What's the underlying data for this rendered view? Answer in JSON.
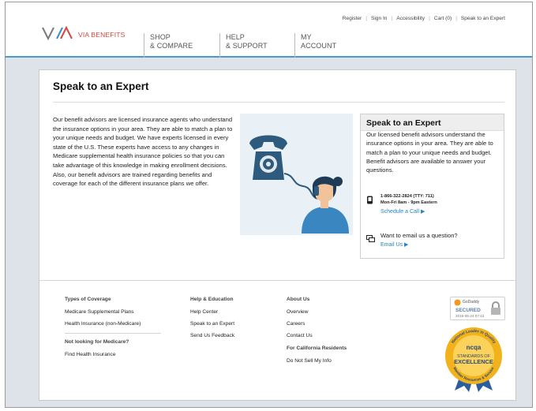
{
  "header": {
    "logo_text": "VIA BENEFITS",
    "utility": [
      "Register",
      "Sign In",
      "Accessibility",
      "Cart (0)",
      "Speak to an Expert"
    ],
    "nav": [
      {
        "line1": "SHOP",
        "line2": "& COMPARE"
      },
      {
        "line1": "HELP",
        "line2": "& SUPPORT"
      },
      {
        "line1": "MY",
        "line2": "ACCOUNT"
      }
    ]
  },
  "main": {
    "title": "Speak to an Expert",
    "intro": "Our benefit advisors are licensed insurance agents who understand the insurance options in your area. They are able to match a plan to your unique needs and budget. We have experts licensed in every state of the U.S. These experts have access to any changes in Medicare supplemental health insurance policies so that you can take advantage of this knowledge in making enrollment decisions. Also, our benefit advisors are trained regarding benefits and coverage for each of the different insurance plans we offer.",
    "panel": {
      "heading": "Speak to an Expert",
      "text": "Our licensed benefit advisors understand the insurance options in your area. They are able to match a plan to your unique needs and budget. Benefit advisors are available to answer your questions.",
      "phone": "1-866-322-2824 (TTY: 711)",
      "hours": "Mon-Fri 8am - 9pm Eastern",
      "schedule_link": "Schedule a Call ▶",
      "email_question": "Want to email us a question?",
      "email_link": "Email Us ▶"
    }
  },
  "footer": {
    "col1": {
      "heading": "Types of Coverage",
      "items": [
        "Medicare Supplemental Plans",
        "Health Insurance (non-Medicare)"
      ],
      "heading2": "Not looking for Medicare?",
      "items2": [
        "Find Health Insurance"
      ]
    },
    "col2": {
      "heading": "Help & Education",
      "items": [
        "Help Center",
        "Speak to an Expert",
        "Send Us Feedback"
      ]
    },
    "col3": {
      "heading": "About Us",
      "items": [
        "Overview",
        "Careers",
        "Contact Us"
      ],
      "heading2": "For California Residents",
      "items2": [
        "Do Not Sell My Info"
      ]
    },
    "badges": {
      "godaddy_name": "GoDaddy",
      "godaddy_secured": "SECURED",
      "godaddy_date": "2016-05-24 07:42",
      "ncqa_top": "National Leader in Quality",
      "ncqa_logo": "ncqa",
      "ncqa_line1": "STANDARDS OF",
      "ncqa_line2": "EXCELLENCE",
      "ncqa_bottom": "Member Resources & Service"
    }
  },
  "colors": {
    "accent_blue": "#4a9ac9",
    "link_blue": "#2a84c2",
    "brand_red": "#d9453f",
    "page_bg": "#dde3e8"
  }
}
